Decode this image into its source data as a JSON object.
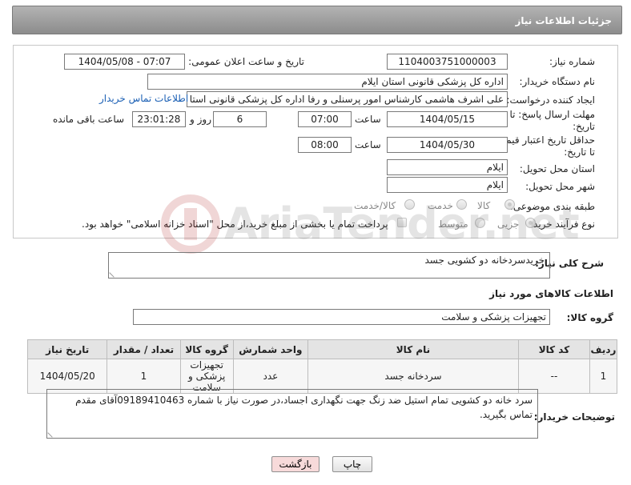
{
  "header": {
    "title": "جزئیات اطلاعات نیاز"
  },
  "form": {
    "need_number_label": "شماره نیاز:",
    "need_number": "1104003751000003",
    "announce_label": "تاریخ و ساعت اعلان عمومی:",
    "announce_value": "1404/05/08 - 07:07",
    "buyer_org_label": "نام دستگاه خریدار:",
    "buyer_org": "اداره کل پزشکی قانونی استان ایلام",
    "creator_label": "ایجاد کننده درخواست:",
    "creator": "علی اشرف هاشمی کارشناس امور پرسنلی و رفا اداره کل پزشکی قانونی استا",
    "contact_link": "اطلاعات تماس خریدار",
    "deadline_label_1": "مهلت ارسال پاسخ: تا",
    "deadline_label_2": "تاریخ:",
    "deadline_date": "1404/05/15",
    "time_label": "ساعت",
    "deadline_time": "07:00",
    "days_value": "6",
    "days_label": "روز و",
    "remaining_time": "23:01:28",
    "remaining_label": "ساعت باقی مانده",
    "validity_label_1": "حداقل تاریخ اعتبار قیمت:",
    "validity_label_2": "تا تاریخ:",
    "validity_date": "1404/05/30",
    "validity_time": "08:00",
    "province_label": "استان محل تحویل:",
    "province": "ایلام",
    "city_label": "شهر محل تحویل:",
    "city": "ایلام",
    "category_label": "طبقه بندی موضوعی:",
    "category_options": [
      "کالا",
      "خدمت",
      "کالا/خدمت"
    ],
    "category_selected": "کالا",
    "process_label": "نوع فرآیند خرید :",
    "process_options": [
      "جزیی",
      "متوسط"
    ],
    "process_selected": "جزیی",
    "payment_note": "پرداخت تمام یا بخشی از مبلغ خرید،از محل \"اسناد خزانه اسلامی\" خواهد بود."
  },
  "description": {
    "label": "شرح کلی نیاز:",
    "value": "خریدسردخانه دو کشویی جسد"
  },
  "goods": {
    "section_title": "اطلاعات کالاهای مورد نیاز",
    "group_label": "گروه کالا:",
    "group_value": "تجهیزات پزشکی و سلامت",
    "columns": [
      "ردیف",
      "کد کالا",
      "نام کالا",
      "واحد شمارش",
      "گروه کالا",
      "تعداد / مقدار",
      "تاریخ نیاز"
    ],
    "rows": [
      {
        "row": "1",
        "code": "--",
        "name": "سردخانه جسد",
        "unit": "عدد",
        "group": "تجهیزات پزشکی و سلامت",
        "qty": "1",
        "date": "1404/05/20"
      }
    ]
  },
  "notes": {
    "label": "توضیحات خریدار:",
    "value": "سرد خانه دو کشویی تمام استیل ضد زنگ جهت نگهداری اجساد،در صورت نیاز با شماره 09189410463آقای مقدم تماس بگیرید."
  },
  "buttons": {
    "print": "چاپ",
    "back": "بازگشت"
  },
  "watermark": {
    "text": "AriaTender.net"
  },
  "colors": {
    "header_bg": "#9e9e9e",
    "link": "#1a5fb4",
    "back_button": "#f7dada",
    "print_button": "#eeeeee"
  }
}
